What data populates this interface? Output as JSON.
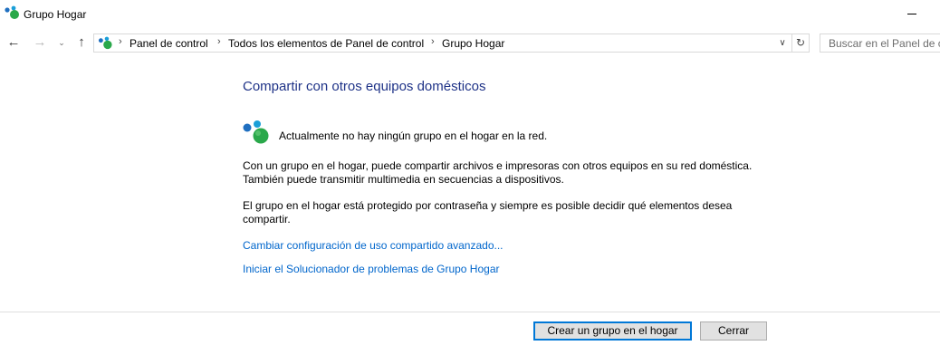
{
  "window": {
    "title": "Grupo Hogar",
    "icon": "homegroup-icon"
  },
  "navigation": {
    "back_icon": "arrow-left-icon",
    "forward_icon": "arrow-right-icon",
    "recent_icon": "chevron-down-icon",
    "up_icon": "arrow-up-icon"
  },
  "address_bar": {
    "breadcrumbs": [
      "Panel de control",
      "Todos los elementos de Panel de control",
      "Grupo Hogar"
    ],
    "dropdown_icon": "chevron-down-icon",
    "refresh_icon": "refresh-icon"
  },
  "search": {
    "placeholder": "Buscar en el Panel de control"
  },
  "main": {
    "heading": "Compartir con otros equipos domésticos",
    "status_text": "Actualmente no hay ningún grupo en el hogar en la red.",
    "paragraph1": "Con un grupo en el hogar, puede compartir archivos e impresoras con otros equipos en su red doméstica. También puede transmitir multimedia en secuencias a dispositivos.",
    "paragraph2": "El grupo en el hogar está protegido por contraseña y siempre es posible decidir qué elementos desea compartir.",
    "link_advanced": "Cambiar configuración de uso compartido avanzado...",
    "link_troubleshooter": "Iniciar el Solucionador de problemas de Grupo Hogar"
  },
  "footer": {
    "create_button": "Crear un grupo en el hogar",
    "close_button": "Cerrar"
  },
  "colors": {
    "heading": "#1e3287",
    "link": "#0066cc",
    "focus_border": "#0078d7"
  }
}
